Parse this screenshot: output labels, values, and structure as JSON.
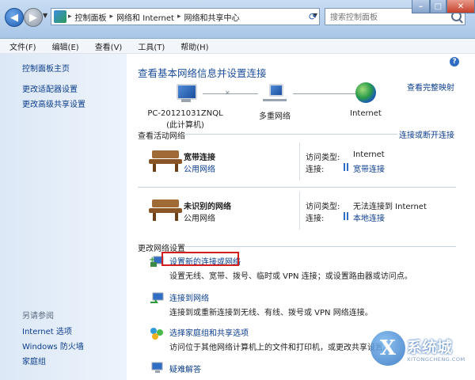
{
  "address_bar": {
    "breadcrumbs": [
      "控制面板",
      "网络和 Internet",
      "网络和共享中心"
    ],
    "search_placeholder": "搜索控制面板"
  },
  "menu": [
    "文件(F)",
    "编辑(E)",
    "查看(V)",
    "工具(T)",
    "帮助(H)"
  ],
  "sidebar": {
    "items": [
      "控制面板主页",
      "更改适配器设置",
      "更改高级共享设置"
    ],
    "see_also_header": "另请参阅",
    "see_also": [
      "Internet 选项",
      "Windows 防火墙",
      "家庭组"
    ]
  },
  "main": {
    "title": "查看基本网络信息并设置连接",
    "view_full_map": "查看完整映射",
    "network_map": {
      "computer_name": "PC-20121031ZNQL",
      "computer_sub": "(此计算机)",
      "middle": "多重网络",
      "internet": "Internet"
    },
    "active_networks_header": "查看活动网络",
    "connect_disconnect": "连接或断开连接",
    "networks": [
      {
        "name": "宽带连接",
        "type": "公用网络",
        "access_label": "访问类型:",
        "access_value": "Internet",
        "conn_label": "连接:",
        "conn_value": "宽带连接"
      },
      {
        "name": "未识别的网络",
        "type": "公用网络",
        "access_label": "访问类型:",
        "access_value": "无法连接到 Internet",
        "conn_label": "连接:",
        "conn_value": "本地连接"
      }
    ],
    "change_settings_header": "更改网络设置",
    "tasks": [
      {
        "link": "设置新的连接或网络",
        "desc": "设置无线、宽带、拨号、临时或 VPN 连接；或设置路由器或访问点。"
      },
      {
        "link": "连接到网络",
        "desc": "连接到或重新连接到无线、有线、拨号或 VPN 网络连接。"
      },
      {
        "link": "选择家庭组和共享选项",
        "desc": "访问位于其他网络计算机上的文件和打印机，或更改共享设置。"
      },
      {
        "link": "疑难解答",
        "desc": ""
      }
    ]
  },
  "watermark": {
    "text": "系统城",
    "url": "XITONGCHENG.COM"
  }
}
